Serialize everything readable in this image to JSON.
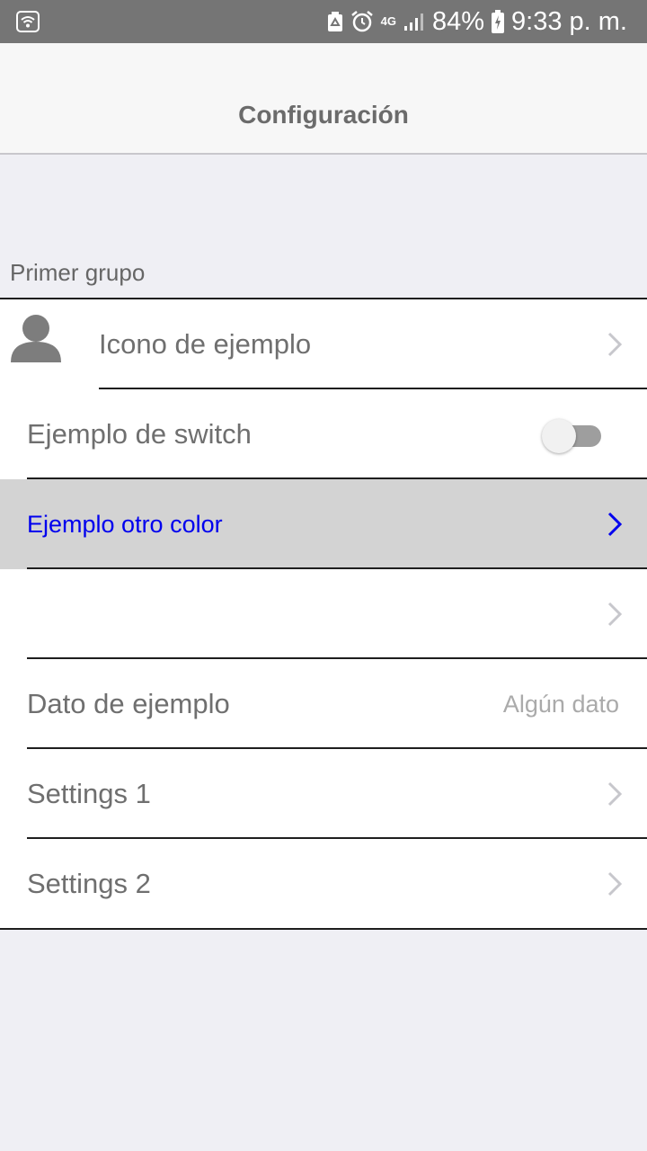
{
  "status_bar": {
    "icons": [
      "wifi-icon",
      "recycle-icon",
      "alarm-icon",
      "network-4g-icon",
      "signal-icon",
      "battery-charging-icon"
    ],
    "network": "4G",
    "battery": "84%",
    "time": "9:33 p. m."
  },
  "header": {
    "title": "Configuración"
  },
  "group": {
    "header": "Primer grupo",
    "items": [
      {
        "label": "Icono de ejemplo",
        "icon": "person-icon",
        "accessory": "chevron"
      },
      {
        "label": "Ejemplo de switch",
        "accessory": "switch",
        "switch_on": false
      },
      {
        "label": "Ejemplo otro color",
        "accessory": "chevron",
        "highlighted": true,
        "text_color": "#0000ee"
      },
      {
        "label": "",
        "accessory": "chevron"
      },
      {
        "label": "Dato de ejemplo",
        "detail": "Algún dato"
      },
      {
        "label": "Settings 1",
        "accessory": "chevron"
      },
      {
        "label": "Settings 2",
        "accessory": "chevron"
      }
    ]
  },
  "colors": {
    "status_bar": "#757575",
    "nav_bar": "#f7f7f7",
    "background": "#efeff4",
    "highlight_row": "#d3d3d3",
    "accent_text": "#0000ee"
  }
}
